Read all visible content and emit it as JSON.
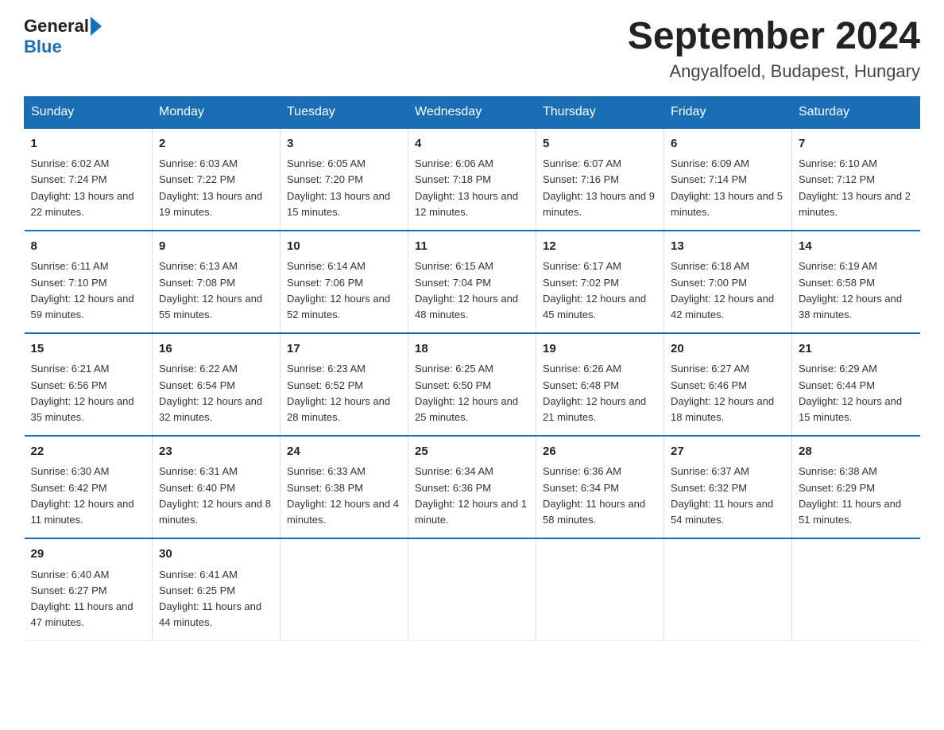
{
  "header": {
    "logo_general": "General",
    "logo_blue": "Blue",
    "month_title": "September 2024",
    "location": "Angyalfoeld, Budapest, Hungary"
  },
  "days_of_week": [
    "Sunday",
    "Monday",
    "Tuesday",
    "Wednesday",
    "Thursday",
    "Friday",
    "Saturday"
  ],
  "weeks": [
    [
      {
        "day": "1",
        "sunrise": "6:02 AM",
        "sunset": "7:24 PM",
        "daylight": "13 hours and 22 minutes."
      },
      {
        "day": "2",
        "sunrise": "6:03 AM",
        "sunset": "7:22 PM",
        "daylight": "13 hours and 19 minutes."
      },
      {
        "day": "3",
        "sunrise": "6:05 AM",
        "sunset": "7:20 PM",
        "daylight": "13 hours and 15 minutes."
      },
      {
        "day": "4",
        "sunrise": "6:06 AM",
        "sunset": "7:18 PM",
        "daylight": "13 hours and 12 minutes."
      },
      {
        "day": "5",
        "sunrise": "6:07 AM",
        "sunset": "7:16 PM",
        "daylight": "13 hours and 9 minutes."
      },
      {
        "day": "6",
        "sunrise": "6:09 AM",
        "sunset": "7:14 PM",
        "daylight": "13 hours and 5 minutes."
      },
      {
        "day": "7",
        "sunrise": "6:10 AM",
        "sunset": "7:12 PM",
        "daylight": "13 hours and 2 minutes."
      }
    ],
    [
      {
        "day": "8",
        "sunrise": "6:11 AM",
        "sunset": "7:10 PM",
        "daylight": "12 hours and 59 minutes."
      },
      {
        "day": "9",
        "sunrise": "6:13 AM",
        "sunset": "7:08 PM",
        "daylight": "12 hours and 55 minutes."
      },
      {
        "day": "10",
        "sunrise": "6:14 AM",
        "sunset": "7:06 PM",
        "daylight": "12 hours and 52 minutes."
      },
      {
        "day": "11",
        "sunrise": "6:15 AM",
        "sunset": "7:04 PM",
        "daylight": "12 hours and 48 minutes."
      },
      {
        "day": "12",
        "sunrise": "6:17 AM",
        "sunset": "7:02 PM",
        "daylight": "12 hours and 45 minutes."
      },
      {
        "day": "13",
        "sunrise": "6:18 AM",
        "sunset": "7:00 PM",
        "daylight": "12 hours and 42 minutes."
      },
      {
        "day": "14",
        "sunrise": "6:19 AM",
        "sunset": "6:58 PM",
        "daylight": "12 hours and 38 minutes."
      }
    ],
    [
      {
        "day": "15",
        "sunrise": "6:21 AM",
        "sunset": "6:56 PM",
        "daylight": "12 hours and 35 minutes."
      },
      {
        "day": "16",
        "sunrise": "6:22 AM",
        "sunset": "6:54 PM",
        "daylight": "12 hours and 32 minutes."
      },
      {
        "day": "17",
        "sunrise": "6:23 AM",
        "sunset": "6:52 PM",
        "daylight": "12 hours and 28 minutes."
      },
      {
        "day": "18",
        "sunrise": "6:25 AM",
        "sunset": "6:50 PM",
        "daylight": "12 hours and 25 minutes."
      },
      {
        "day": "19",
        "sunrise": "6:26 AM",
        "sunset": "6:48 PM",
        "daylight": "12 hours and 21 minutes."
      },
      {
        "day": "20",
        "sunrise": "6:27 AM",
        "sunset": "6:46 PM",
        "daylight": "12 hours and 18 minutes."
      },
      {
        "day": "21",
        "sunrise": "6:29 AM",
        "sunset": "6:44 PM",
        "daylight": "12 hours and 15 minutes."
      }
    ],
    [
      {
        "day": "22",
        "sunrise": "6:30 AM",
        "sunset": "6:42 PM",
        "daylight": "12 hours and 11 minutes."
      },
      {
        "day": "23",
        "sunrise": "6:31 AM",
        "sunset": "6:40 PM",
        "daylight": "12 hours and 8 minutes."
      },
      {
        "day": "24",
        "sunrise": "6:33 AM",
        "sunset": "6:38 PM",
        "daylight": "12 hours and 4 minutes."
      },
      {
        "day": "25",
        "sunrise": "6:34 AM",
        "sunset": "6:36 PM",
        "daylight": "12 hours and 1 minute."
      },
      {
        "day": "26",
        "sunrise": "6:36 AM",
        "sunset": "6:34 PM",
        "daylight": "11 hours and 58 minutes."
      },
      {
        "day": "27",
        "sunrise": "6:37 AM",
        "sunset": "6:32 PM",
        "daylight": "11 hours and 54 minutes."
      },
      {
        "day": "28",
        "sunrise": "6:38 AM",
        "sunset": "6:29 PM",
        "daylight": "11 hours and 51 minutes."
      }
    ],
    [
      {
        "day": "29",
        "sunrise": "6:40 AM",
        "sunset": "6:27 PM",
        "daylight": "11 hours and 47 minutes."
      },
      {
        "day": "30",
        "sunrise": "6:41 AM",
        "sunset": "6:25 PM",
        "daylight": "11 hours and 44 minutes."
      },
      null,
      null,
      null,
      null,
      null
    ]
  ],
  "labels": {
    "sunrise": "Sunrise:",
    "sunset": "Sunset:",
    "daylight": "Daylight:"
  }
}
